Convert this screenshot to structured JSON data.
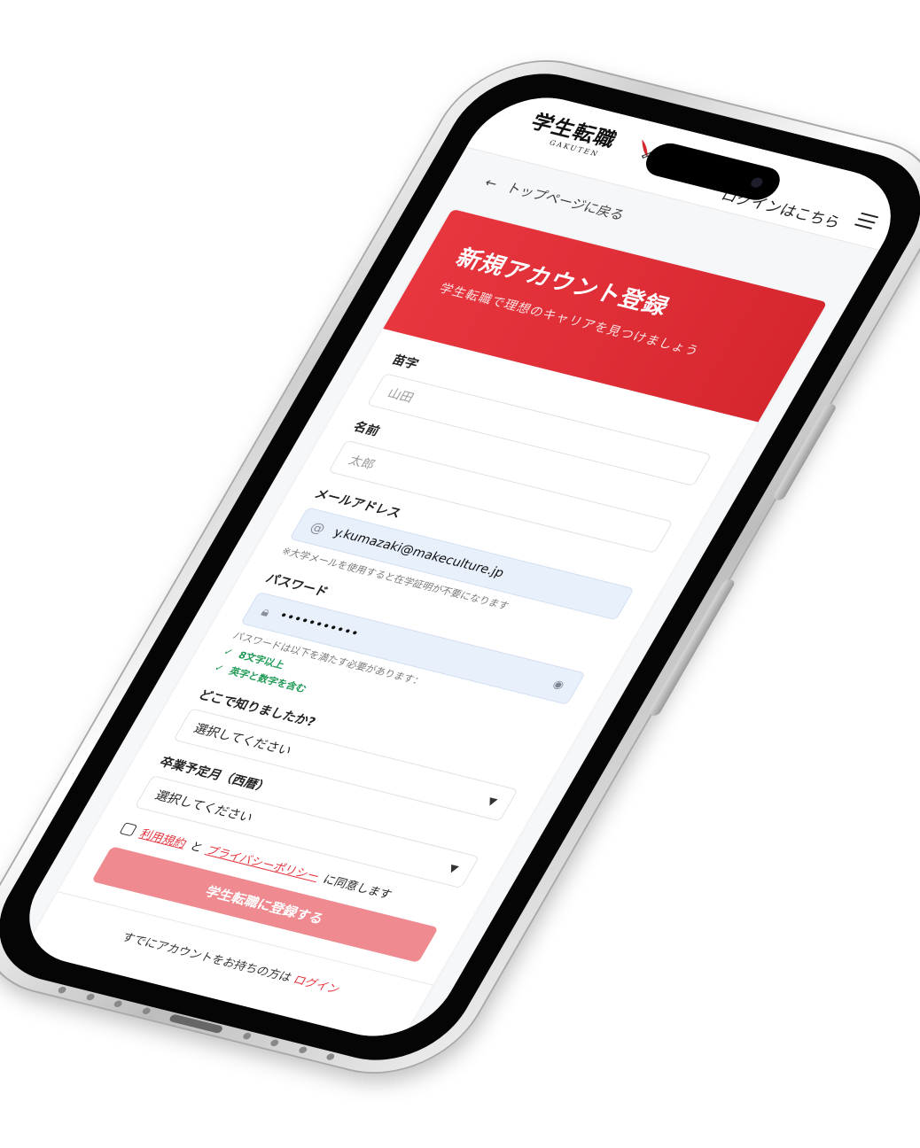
{
  "header": {
    "logo_text": "学生転職",
    "logo_sub": "GAKUTEN",
    "login_link": "ログインはこちら"
  },
  "nav": {
    "back_label": "トップページに戻る"
  },
  "hero": {
    "title": "新規アカウント登録",
    "subtitle": "学生転職で理想のキャリアを見つけましょう"
  },
  "form": {
    "last_name": {
      "label": "苗字",
      "placeholder": "山田"
    },
    "first_name": {
      "label": "名前",
      "placeholder": "太郎"
    },
    "email": {
      "label": "メールアドレス",
      "value": "y.kumazaki@makeculture.jp",
      "hint": "※大学メールを使用すると在学証明が不要になります"
    },
    "password": {
      "label": "パスワード",
      "value": "•••••••••••",
      "requirements_intro": "パスワードは以下を満たす必要があります：",
      "rules": [
        "8文字以上",
        "英字と数字を含む"
      ]
    },
    "referral": {
      "label": "どこで知りましたか?",
      "selected": "選択してください"
    },
    "graduation": {
      "label": "卒業予定月（西暦）",
      "selected": "選択してください"
    },
    "agreement": {
      "terms": "利用規約",
      "and": "と",
      "privacy": "プライバシーポリシー",
      "suffix": "に同意します"
    },
    "submit_label": "学生転職に登録する"
  },
  "footer": {
    "text": "すでにアカウントをお持ちの方は",
    "login_link": "ログイン"
  },
  "colors": {
    "brand_red": "#e5343d",
    "submit_disabled": "#ee8a90",
    "success_green": "#1f9a55",
    "autofill_blue": "#e8f0fc"
  }
}
